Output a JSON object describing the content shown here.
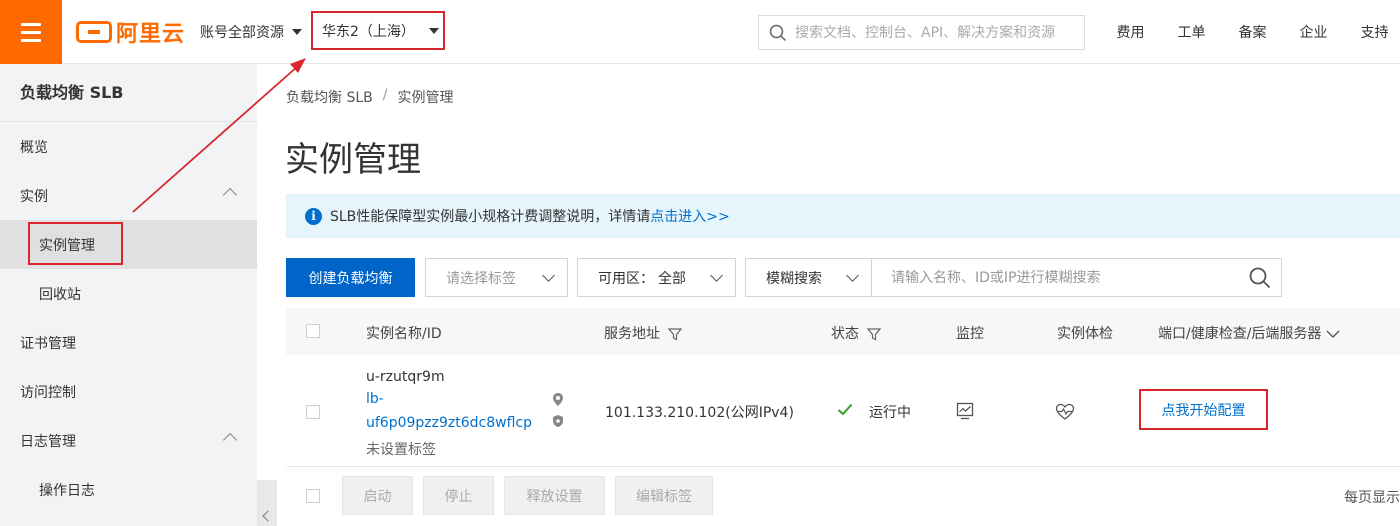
{
  "header": {
    "logo_text": "阿里云",
    "account_select": "账号全部资源",
    "region_select": "华东2（上海）",
    "search_placeholder": "搜索文档、控制台、API、解决方案和资源",
    "nav": [
      "费用",
      "工单",
      "备案",
      "企业",
      "支持"
    ]
  },
  "sidebar": {
    "title": "负载均衡 SLB",
    "items": [
      {
        "label": "概览"
      },
      {
        "label": "实例"
      },
      {
        "label": "实例管理"
      },
      {
        "label": "回收站"
      },
      {
        "label": "证书管理"
      },
      {
        "label": "访问控制"
      },
      {
        "label": "日志管理"
      },
      {
        "label": "操作日志"
      }
    ]
  },
  "breadcrumb": {
    "root": "负载均衡 SLB",
    "sep": "/",
    "current": "实例管理"
  },
  "page_title": "实例管理",
  "notice": {
    "text": "SLB性能保障型实例最小规格计费调整说明，详情请",
    "link": "点击进入>>"
  },
  "toolbar": {
    "create_button": "创建负载均衡",
    "tag_select": "请选择标签",
    "zone_label": "可用区：",
    "zone_value": "全部",
    "search_mode": "模糊搜索",
    "search_placeholder": "请输入名称、ID或IP进行模糊搜索"
  },
  "table": {
    "headers": {
      "name": "实例名称/ID",
      "address": "服务地址",
      "status": "状态",
      "monitor": "监控",
      "health": "实例体检",
      "ports": "端口/健康检查/后端服务器"
    },
    "rows": [
      {
        "name": "u-rzutqr9m",
        "id_line1": "lb-",
        "id_line2": "uf6p09pzz9zt6dc8wflcp",
        "tag": "未设置标签",
        "address": "101.133.210.102(公网IPv4)",
        "status": "运行中",
        "config_link": "点我开始配置"
      }
    ]
  },
  "footer": {
    "buttons": [
      "启动",
      "停止",
      "释放设置",
      "编辑标签"
    ],
    "per_page": "每页显示"
  },
  "colors": {
    "brand": "#ff6a00",
    "primary": "#0064c8",
    "annotation": "#d9262c",
    "success": "#2ea121"
  }
}
